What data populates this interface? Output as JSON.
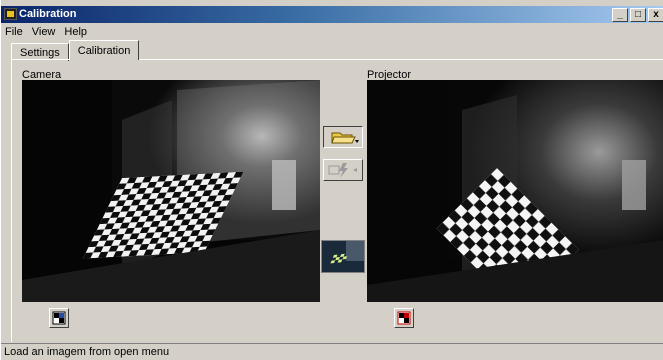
{
  "window": {
    "title": "Calibration"
  },
  "titlebar_buttons": [
    "_",
    "□",
    "x"
  ],
  "menu": [
    "File",
    "View",
    "Help"
  ],
  "tabs": [
    {
      "label": "Settings",
      "active": false
    },
    {
      "label": "Calibration",
      "active": true
    }
  ],
  "camera": {
    "caption": "Camera"
  },
  "projector": {
    "caption": "Projector"
  },
  "status": {
    "text": "Load an imagem from open menu"
  },
  "icons": {
    "open": "open-folder-icon",
    "capture": "camera-flash-icon",
    "pattern_camera": "checker-pattern-icon",
    "pattern_projector": "checker-pattern-icon"
  },
  "colors": {
    "titlebar_start": "#0a246a",
    "titlebar_end": "#a6caf0",
    "face": "#d4d0c8"
  }
}
